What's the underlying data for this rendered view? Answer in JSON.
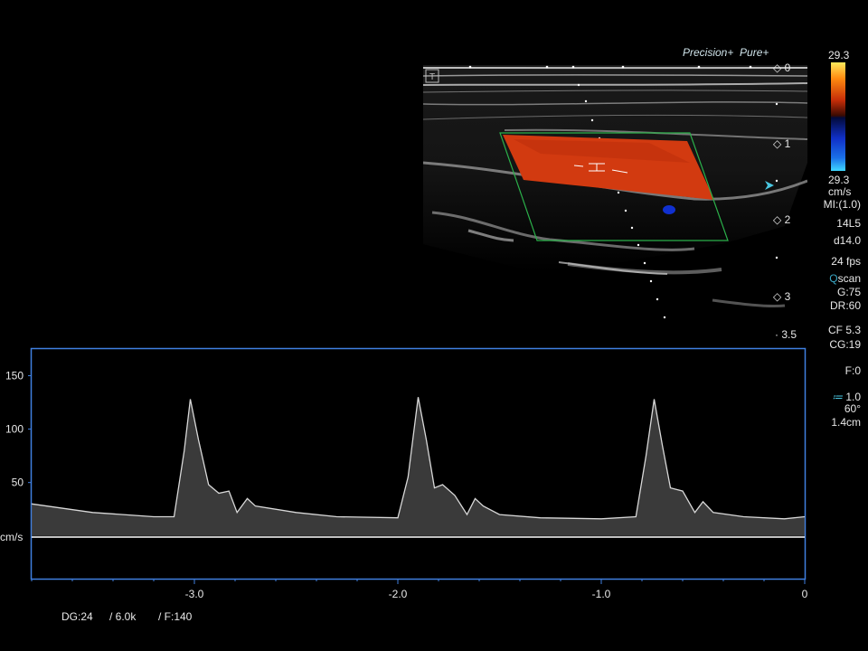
{
  "brand": {
    "precision": "Precision+",
    "pure": "Pure+"
  },
  "colorbar": {
    "top_value": "29.3",
    "bottom_value": "29.3",
    "unit": "cm/s"
  },
  "parameters": {
    "mi": "MI:(1.0)",
    "probe": "14L5",
    "depth": "d14.0",
    "fps": "24 fps",
    "qscan": "scan",
    "qscan_letter": "Q",
    "gain": "G:75",
    "dr": "DR:60",
    "cf": "CF 5.3",
    "cg": "CG:19",
    "filter": "F:0",
    "angle_scale": "1.0",
    "angle": "60°",
    "gate": "1.4cm"
  },
  "depth_scale": [
    "0",
    "1",
    "2",
    "3",
    "3.5"
  ],
  "doppler": {
    "y_ticks": [
      "150",
      "100",
      "50"
    ],
    "y_unit": "cm/s",
    "x_ticks": [
      "-3.0",
      "-2.0",
      "-1.0",
      "0"
    ]
  },
  "footer": {
    "dg": "DG:24",
    "prf": "/ 6.0k",
    "frame": "/ F:140"
  },
  "colors": {
    "accent_blue": "#3f7fe0",
    "flow_red": "#d23a10",
    "roi_green": "#2bb04a"
  },
  "chart_data": {
    "type": "line",
    "xlabel": "",
    "ylabel": "cm/s",
    "xlim": [
      -3.8,
      0
    ],
    "ylim": [
      -40,
      175
    ],
    "x_ticks": [
      -3.0,
      -2.0,
      -1.0,
      0
    ],
    "y_ticks": [
      150,
      100,
      50
    ],
    "grid": false,
    "series": [
      {
        "x": [
          -3.8,
          -3.5,
          -3.2,
          -3.1,
          -3.05,
          -3.02,
          -2.98,
          -2.93,
          -2.88,
          -2.83,
          -2.79,
          -2.74,
          -2.7,
          -2.5,
          -2.3,
          -2.0,
          -1.95,
          -1.9,
          -1.86,
          -1.82,
          -1.78,
          -1.72,
          -1.66,
          -1.62,
          -1.58,
          -1.5,
          -1.3,
          -1.0,
          -0.83,
          -0.78,
          -0.74,
          -0.7,
          -0.66,
          -0.6,
          -0.54,
          -0.5,
          -0.45,
          -0.3,
          -0.1,
          0
        ],
        "y": [
          30,
          22,
          18,
          18,
          80,
          128,
          90,
          48,
          40,
          42,
          22,
          35,
          28,
          22,
          18,
          17,
          55,
          130,
          90,
          45,
          48,
          38,
          20,
          35,
          28,
          20,
          17,
          16,
          18,
          75,
          128,
          85,
          45,
          42,
          22,
          32,
          22,
          18,
          16,
          18
        ]
      }
    ]
  }
}
